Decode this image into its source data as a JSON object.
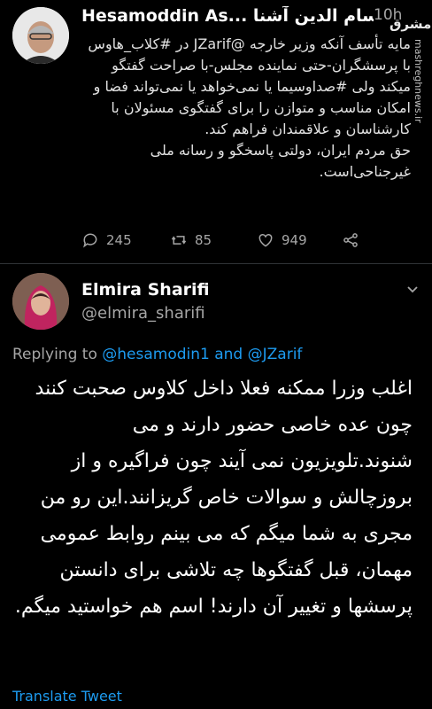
{
  "tweet1": {
    "author_name": "Hesamoddin As... حسام الدین آشنا",
    "time": "10h",
    "text": "مایه تأسف آنکه وزیر خارجه @JZarif در #کلاب_هاوس با پرسشگران-حتی نماینده مجلس-با صراحت گفتگو میکند ولی #صداوسیما یا نمی‌خواهد یا نمی‌تواند فضا و امکان مناسب و متوازن را برای گفتگوی مسئولان با کارشناسان و علاقمندان فراهم کند.\nحق مردم ایران، دولتی پاسخگو و رسانه ملی غیرجناحی‌است.",
    "stats": {
      "replies": "245",
      "retweets": "85",
      "likes": "949"
    }
  },
  "tweet2": {
    "author_name": "Elmira Sharifi",
    "handle": "@elmira_sharifi",
    "replying_prefix": "Replying to",
    "replying_mention1": "@hesamodin1",
    "replying_and": "and",
    "replying_mention2": "@JZarif",
    "text": "اغلب وزرا ممکنه فعلا داخل کلاوس صحبت کنند چون عده خاصی حضور دارند و می شنوند.تلویزیون نمی آیند چون فراگیره و از بروزچالش و سوالات خاص گریزانند.این رو من مجری به شما میگم که می بینم روابط عمومی مهمان، قبل گفتگوها چه تلاشی برای دانستن پرسشها و تغییر آن دارند! اسم هم خواستید میگم.",
    "translate_label": "Translate Tweet"
  },
  "watermark": {
    "logo": "مشرق",
    "url": "mashreghnews.ir"
  }
}
